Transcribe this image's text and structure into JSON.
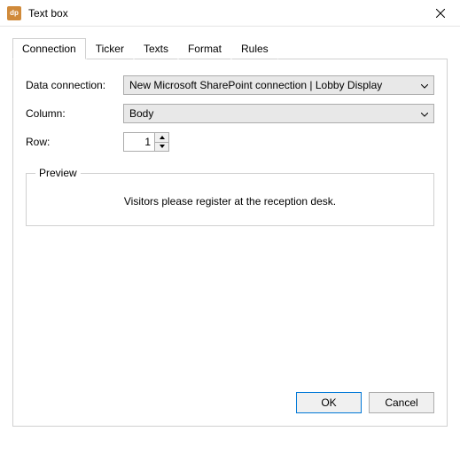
{
  "window": {
    "title": "Text box",
    "icon_text": "dp"
  },
  "tabs": {
    "t0": "Connection",
    "t1": "Ticker",
    "t2": "Texts",
    "t3": "Format",
    "t4": "Rules"
  },
  "form": {
    "data_connection_label": "Data connection:",
    "data_connection_value": "New Microsoft SharePoint connection | Lobby Display",
    "column_label": "Column:",
    "column_value": "Body",
    "row_label": "Row:",
    "row_value": "1"
  },
  "preview": {
    "legend": "Preview",
    "text": "Visitors please register at the reception desk."
  },
  "buttons": {
    "ok": "OK",
    "cancel": "Cancel"
  }
}
